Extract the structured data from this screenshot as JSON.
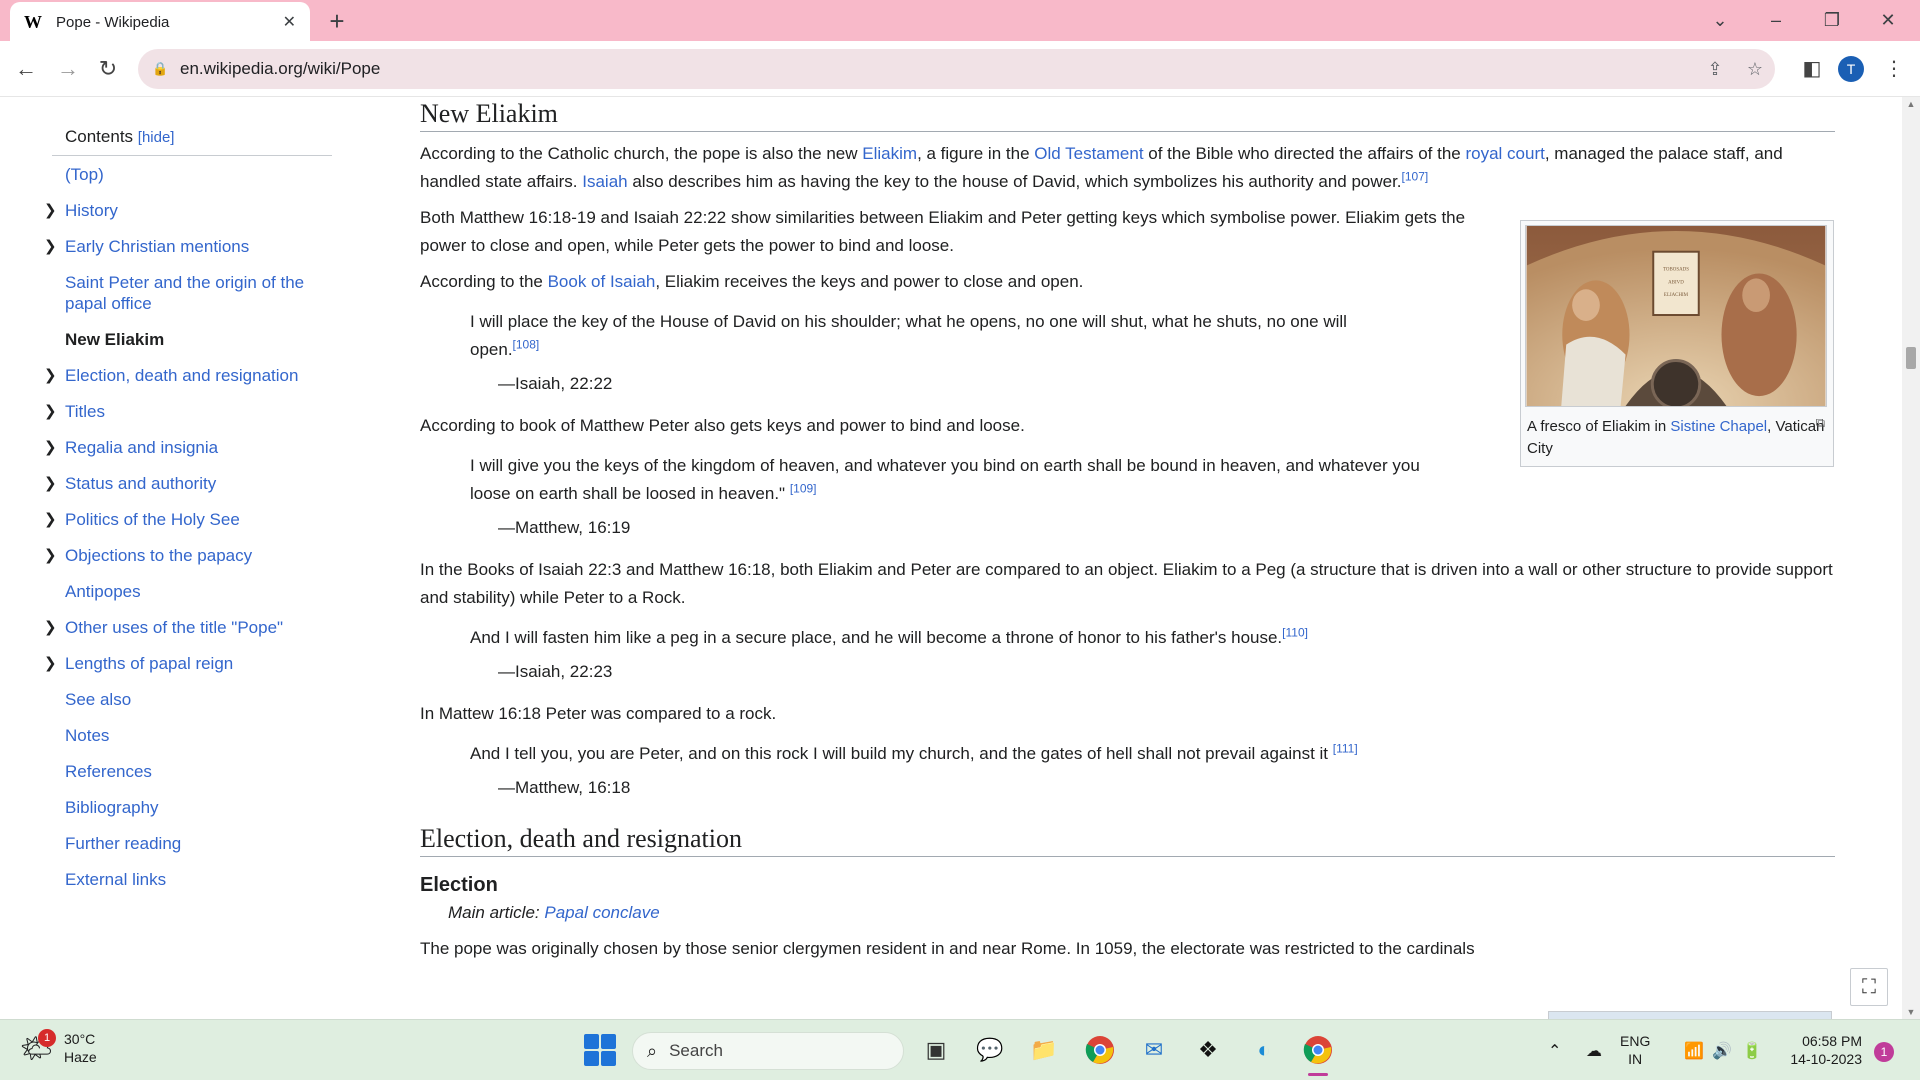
{
  "browser": {
    "tab_title": "Pope - Wikipedia",
    "tab_favicon": "W",
    "url": "en.wikipedia.org/wiki/Pope",
    "profile_initial": "T"
  },
  "toc": {
    "title": "Contents",
    "hide_label": "[hide]",
    "items": [
      {
        "label": "(Top)",
        "expandable": false,
        "active": false
      },
      {
        "label": "History",
        "expandable": true,
        "active": false
      },
      {
        "label": "Early Christian mentions",
        "expandable": true,
        "active": false
      },
      {
        "label": "Saint Peter and the origin of the papal office",
        "expandable": false,
        "active": false
      },
      {
        "label": "New Eliakim",
        "expandable": false,
        "active": true
      },
      {
        "label": "Election, death and resignation",
        "expandable": true,
        "active": false
      },
      {
        "label": "Titles",
        "expandable": true,
        "active": false
      },
      {
        "label": "Regalia and insignia",
        "expandable": true,
        "active": false
      },
      {
        "label": "Status and authority",
        "expandable": true,
        "active": false
      },
      {
        "label": "Politics of the Holy See",
        "expandable": true,
        "active": false
      },
      {
        "label": "Objections to the papacy",
        "expandable": true,
        "active": false
      },
      {
        "label": "Antipopes",
        "expandable": false,
        "active": false
      },
      {
        "label": "Other uses of the title \"Pope\"",
        "expandable": true,
        "active": false
      },
      {
        "label": "Lengths of papal reign",
        "expandable": true,
        "active": false
      },
      {
        "label": "See also",
        "expandable": false,
        "active": false
      },
      {
        "label": "Notes",
        "expandable": false,
        "active": false
      },
      {
        "label": "References",
        "expandable": false,
        "active": false
      },
      {
        "label": "Bibliography",
        "expandable": false,
        "active": false
      },
      {
        "label": "Further reading",
        "expandable": false,
        "active": false
      },
      {
        "label": "External links",
        "expandable": false,
        "active": false
      }
    ]
  },
  "article": {
    "section1_title": "New Eliakim",
    "p1": {
      "t1": "According to the Catholic church, the pope is also the new ",
      "l1": "Eliakim",
      "t2": ", a figure in the ",
      "l2": "Old Testament",
      "t3": " of the Bible who directed the affairs of the ",
      "l3": "royal court",
      "t4": ", managed the palace staff, and handled state affairs. ",
      "l4": "Isaiah",
      "t5": " also describes him as having the key to the house of David, which symbolizes his authority and power.",
      "ref": "[107]"
    },
    "p2": "Both Matthew 16:18-19 and Isaiah 22:22 show similarities between Eliakim and Peter getting keys which symbolise power. Eliakim gets the power to close and open, while Peter gets the power to bind and loose.",
    "p3": {
      "t1": "According to the ",
      "l1": "Book of Isaiah",
      "t2": ", Eliakim receives the keys and power to close and open."
    },
    "q1": {
      "text": "I will place the key of the House of David on his shoulder; what he opens, no one will shut, what he shuts, no one will open.",
      "ref": "[108]",
      "cite": "—Isaiah, 22:22"
    },
    "p4": "According to book of Matthew Peter also gets keys and power to bind and loose.",
    "q2": {
      "text": "I will give you the keys of the kingdom of heaven, and whatever you bind on earth shall be bound in heaven, and whatever you loose on earth shall be loosed in heaven.\" ",
      "ref": "[109]",
      "cite": "—Matthew, 16:19"
    },
    "p5": "In the Books of Isaiah 22:3 and Matthew 16:18, both Eliakim and Peter are compared to an object. Eliakim to a Peg (a structure that is driven into a wall or other structure to provide support and stability) while Peter to a Rock.",
    "q3": {
      "text": "And I will fasten him like a peg in a secure place, and he will become a throne of honor to his father's house.",
      "ref": "[110]",
      "cite": "—Isaiah, 22:23"
    },
    "p6": "In Mattew 16:18 Peter was compared to a rock.",
    "q4": {
      "text": "And I tell you, you are Peter, and on this rock I will build my church, and the gates of hell shall not prevail against it ",
      "ref": "[111]",
      "cite": "—Matthew, 16:18"
    },
    "section2_title": "Election, death and resignation",
    "subsection_title": "Election",
    "hatnote_prefix": "Main article: ",
    "hatnote_link": "Papal conclave",
    "p7": "The pope was originally chosen by those senior clergymen resident in and near Rome. In 1059, the electorate was restricted to the cardinals"
  },
  "figure": {
    "image_text": [
      "TOBOSADS",
      "ABIVD",
      "ELIACHIM"
    ],
    "caption_t1": "A fresco of Eliakim in ",
    "caption_link": "Sistine Chapel",
    "caption_t2": ", Vatican City"
  },
  "taskbar": {
    "temperature": "30°C",
    "condition": "Haze",
    "weather_badge": "1",
    "search_label": "Search",
    "lang_line1": "ENG",
    "lang_line2": "IN",
    "time": "06:58 PM",
    "date": "14-10-2023",
    "notification_count": "1"
  },
  "colors": {
    "tabbar": "#f8b9c9",
    "link": "#3366cc",
    "taskbar": "#dfeee0"
  }
}
